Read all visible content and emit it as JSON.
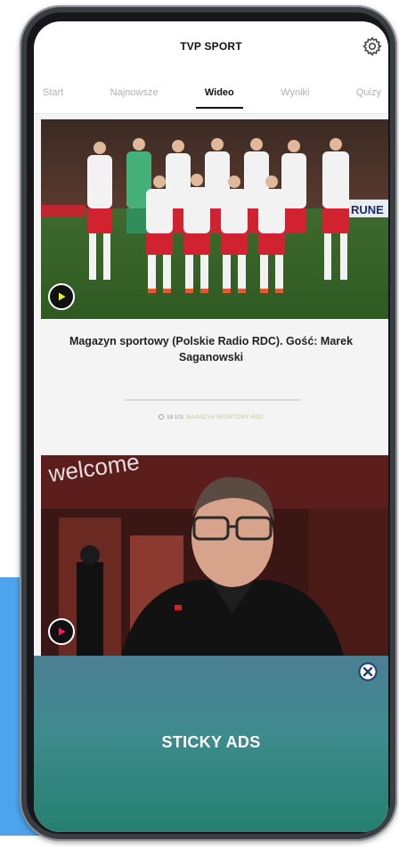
{
  "header": {
    "brand": "TVP SPORT",
    "settings_icon": "gear-icon"
  },
  "tabs": [
    {
      "label": "Start",
      "active": false
    },
    {
      "label": "Najnowsze",
      "active": false
    },
    {
      "label": "Wideo",
      "active": true
    },
    {
      "label": "Wyniki",
      "active": false
    },
    {
      "label": "Quizy",
      "active": false
    }
  ],
  "cards": [
    {
      "title": "Magazyn sportowy (Polskie Radio RDC). Gość: Marek Saganowski",
      "date": "18 LIS",
      "tag": "MAGAZYN SPORTOWY RDC",
      "image_text": "RUNE",
      "play_icon": "play-icon"
    },
    {
      "image_text": "welcome",
      "play_icon": "play-icon"
    }
  ],
  "sticky_ad": {
    "label": "STICKY ADS",
    "close_icon": "close-icon"
  },
  "colors": {
    "accent_blue": "#4da3ec",
    "ad_top": "#4b7f92",
    "ad_bottom": "#25806f",
    "tag_green": "#b9c98b"
  }
}
